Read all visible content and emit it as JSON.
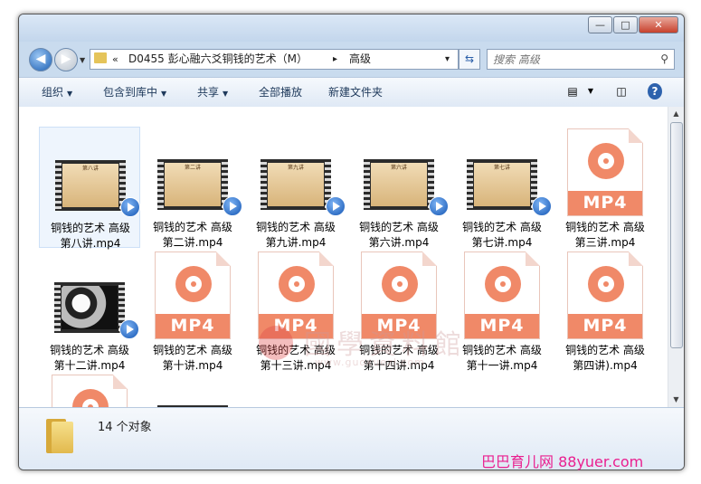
{
  "window": {
    "min": "—",
    "max": "□",
    "close": "✕"
  },
  "nav": {
    "back": "◀",
    "forward": "▶",
    "history": "▼",
    "breadcrumb_chevron": "«",
    "path_folder": "D0455 彭心融六爻铜钱的艺术（M）",
    "separator": "▸",
    "path_current": "高级",
    "addr_drop": "▾",
    "refresh": "⇆",
    "search_placeholder": "搜索 高级",
    "search_icon": "search-icon"
  },
  "toolbar": {
    "organize": "组织",
    "include": "包含到库中",
    "share": "共享",
    "play_all": "全部播放",
    "new_folder": "新建文件夹",
    "view_icon": "▤",
    "pane_icon": "◫",
    "help": "?"
  },
  "files": [
    {
      "line1": "铜钱的艺术 高级",
      "line2": "第八讲.mp4",
      "kind": "video",
      "frame_text": "第八讲",
      "selected": true
    },
    {
      "line1": "铜钱的艺术 高级",
      "line2": "第二讲.mp4",
      "kind": "video",
      "frame_text": "第二讲"
    },
    {
      "line1": "铜钱的艺术 高级",
      "line2": "第九讲.mp4",
      "kind": "video",
      "frame_text": "第九讲"
    },
    {
      "line1": "铜钱的艺术 高级",
      "line2": "第六讲.mp4",
      "kind": "video",
      "frame_text": "第六讲"
    },
    {
      "line1": "铜钱的艺术 高级",
      "line2": "第七讲.mp4",
      "kind": "video",
      "frame_text": "第七讲"
    },
    {
      "line1": "铜钱的艺术 高级",
      "line2": "第三讲.mp4",
      "kind": "mp4"
    },
    {
      "line1": "铜钱的艺术 高级",
      "line2": "第十二讲.mp4",
      "kind": "video-bw"
    },
    {
      "line1": "铜钱的艺术 高级",
      "line2": "第十讲.mp4",
      "kind": "mp4"
    },
    {
      "line1": "铜钱的艺术 高级",
      "line2": "第十三讲.mp4",
      "kind": "mp4"
    },
    {
      "line1": "铜钱的艺术 高级",
      "line2": "第十四讲.mp4",
      "kind": "mp4"
    },
    {
      "line1": "铜钱的艺术 高级",
      "line2": "第十一讲.mp4",
      "kind": "mp4"
    },
    {
      "line1": "铜钱的艺术 高级",
      "line2": "第四讲).mp4",
      "kind": "mp4"
    },
    {
      "line1": "",
      "line2": "",
      "kind": "mp4"
    },
    {
      "line1": "",
      "line2": "",
      "kind": "video-bw"
    }
  ],
  "mp4_badge": "MP4",
  "status": {
    "count": "14 个对象"
  },
  "watermark": {
    "text": "國學資料館",
    "url": "www.guoxuezl.com"
  },
  "site_watermark": "巴巴育儿网 88yuer.com"
}
